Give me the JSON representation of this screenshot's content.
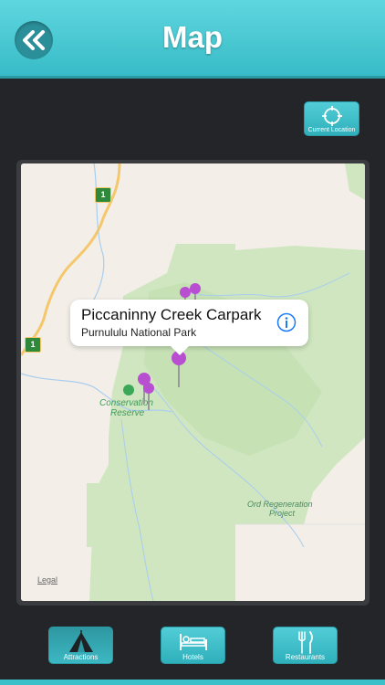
{
  "header": {
    "title": "Map"
  },
  "map": {
    "current_location_label": "Current Location",
    "legal_label": "Legal",
    "highway_shield_1": "1",
    "highway_shield_2": "1",
    "place_label_conservation": "Conservation",
    "place_label_reserve": "Reserve",
    "place_label_ord_1": "Ord Regeneration",
    "place_label_ord_2": "Project",
    "callout": {
      "title": "Piccaninny Creek Carpark",
      "subtitle": "Purnululu National Park"
    },
    "colors": {
      "land": "#f3efe8",
      "park": "#cfe6c0",
      "park_dark": "#bfe0ae",
      "road": "#f5c76b",
      "water": "#a9cdf0",
      "pin": "#b84fd1"
    }
  },
  "tabs": [
    {
      "label": "Attractions",
      "icon": "tent-icon",
      "active": true
    },
    {
      "label": "Hotels",
      "icon": "bed-icon",
      "active": false
    },
    {
      "label": "Restaurants",
      "icon": "fork-knife-icon",
      "active": false
    }
  ],
  "colors": {
    "accent": "#38bcc7",
    "background": "#232529"
  }
}
